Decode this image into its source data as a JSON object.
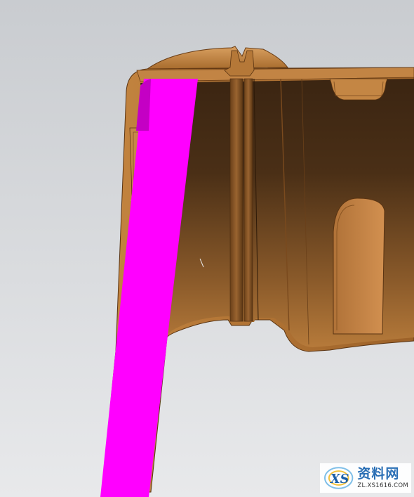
{
  "scene": {
    "background_top": "#cdd0d3",
    "background_bottom": "#e6e8ea",
    "part_color": "#b97a38",
    "part_edge_color": "#5a3412",
    "part_shadow_color": "#3a2410",
    "cut_plane_color": "#ff00ff",
    "cut_plane_dark": "#c800c8"
  },
  "watermark": {
    "title": "资料网",
    "url": "ZL.XS1616.COM",
    "logo_text": "XS",
    "accent": "#2a6fb5"
  }
}
